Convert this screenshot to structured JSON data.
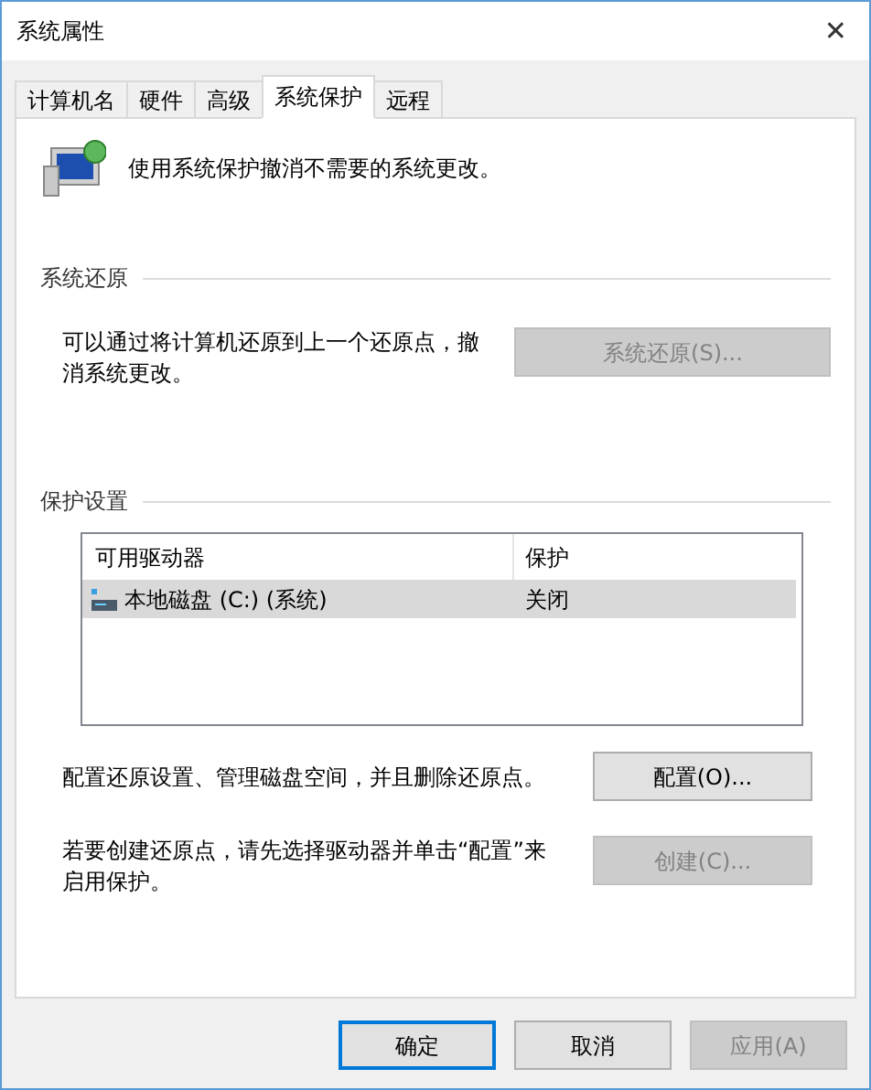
{
  "window": {
    "title": "系统属性",
    "close": "✕"
  },
  "tabs": [
    {
      "label": "计算机名",
      "selected": false
    },
    {
      "label": "硬件",
      "selected": false
    },
    {
      "label": "高级",
      "selected": false
    },
    {
      "label": "系统保护",
      "selected": true
    },
    {
      "label": "远程",
      "selected": false
    }
  ],
  "intro": "使用系统保护撤消不需要的系统更改。",
  "restore": {
    "heading": "系统还原",
    "text": "可以通过将计算机还原到上一个还原点，撤消系统更改。",
    "button": {
      "label": "系统还原(S)...",
      "disabled": true
    }
  },
  "protection": {
    "heading": "保护设置",
    "table": {
      "columns": [
        "可用驱动器",
        "保护"
      ],
      "rows": [
        {
          "drive": "本地磁盘 (C:) (系统)",
          "protection": "关闭",
          "selected": true
        }
      ]
    },
    "configure": {
      "text": "配置还原设置、管理磁盘空间，并且删除还原点。",
      "button": {
        "label": "配置(O)...",
        "disabled": false
      }
    },
    "create": {
      "text": "若要创建还原点，请先选择驱动器并单击“配置”来启用保护。",
      "button": {
        "label": "创建(C)...",
        "disabled": true
      }
    }
  },
  "buttons": [
    {
      "label": "确定",
      "default": true,
      "disabled": false
    },
    {
      "label": "取消",
      "default": false,
      "disabled": false
    },
    {
      "label": "应用(A)",
      "default": false,
      "disabled": true
    }
  ]
}
